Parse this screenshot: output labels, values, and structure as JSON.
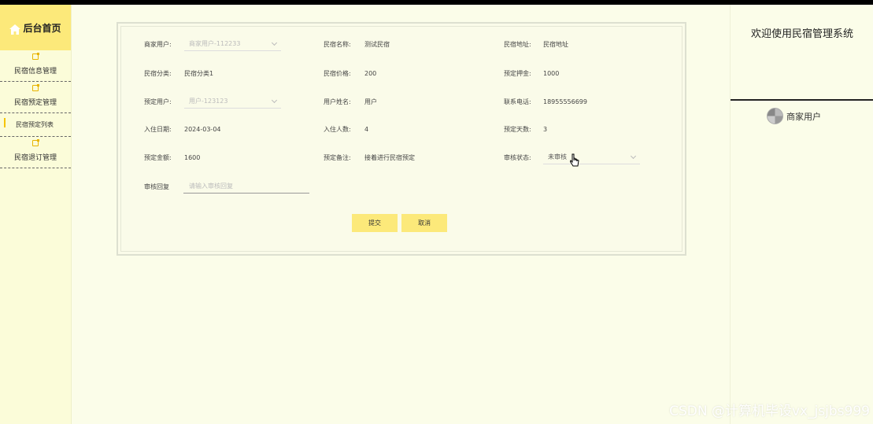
{
  "sidebar": {
    "home_label": "后台首页",
    "menu": [
      {
        "label": "民宿信息管理",
        "icon": "edit-icon"
      },
      {
        "label": "民宿预定管理",
        "icon": "edit-icon"
      },
      {
        "label": "民宿预定列表",
        "icon": ""
      },
      {
        "label": "民宿退订管理",
        "icon": "edit-icon"
      }
    ]
  },
  "form": {
    "merchant_user": {
      "label": "商家用户:",
      "placeholder": "商家用户-112233"
    },
    "homestay_name": {
      "label": "民宿名称:",
      "value": "测试民宿"
    },
    "homestay_address": {
      "label": "民宿地址:",
      "value": "民宿地址"
    },
    "homestay_category": {
      "label": "民宿分类:",
      "value": "民宿分类1"
    },
    "homestay_price": {
      "label": "民宿价格:",
      "value": "200"
    },
    "deposit": {
      "label": "预定押金:",
      "value": "1000"
    },
    "booking_user": {
      "label": "预定用户:",
      "placeholder": "用户-123123"
    },
    "user_name": {
      "label": "用户姓名:",
      "value": "用户"
    },
    "phone": {
      "label": "联系电话:",
      "value": "18955556699"
    },
    "checkin_date": {
      "label": "入住日期:",
      "value": "2024-03-04"
    },
    "guests": {
      "label": "入住人数:",
      "value": "4"
    },
    "days": {
      "label": "预定天数:",
      "value": "3"
    },
    "total": {
      "label": "预定金额:",
      "value": "1600"
    },
    "remark": {
      "label": "预定备注:",
      "value": "接着进行民宿预定"
    },
    "review_status": {
      "label": "审核状态:",
      "value": "未审核"
    },
    "review_reply": {
      "label": "审核回复",
      "placeholder": "请输入审核回复"
    },
    "submit_label": "提交",
    "cancel_label": "取消"
  },
  "right": {
    "welcome": "欢迎使用民宿管理系统",
    "user_role": "商家用户"
  },
  "watermark": "CSDN @计算机毕设vx_jsjbs999",
  "colors": {
    "accent": "#fce97a",
    "background": "#fbfde9",
    "sidebar": "#fbfcd9"
  }
}
